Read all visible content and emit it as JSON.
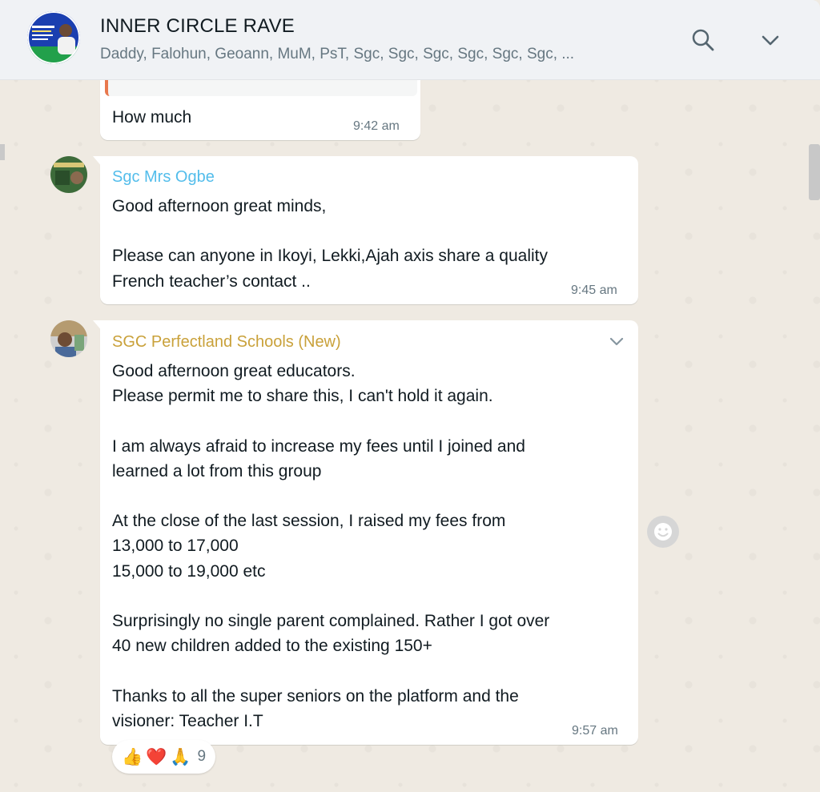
{
  "header": {
    "title": "INNER CIRCLE RAVE",
    "members": "Daddy, Falohun, Geoann, MuM, PsT, Sgc, Sgc, Sgc, Sgc, Sgc, Sgc, ...",
    "avatar_icon": "group-flyer-avatar",
    "search_icon": "search-icon",
    "menu_icon": "chevron-down-icon"
  },
  "messages": [
    {
      "text": "How much",
      "time": "9:42 am"
    },
    {
      "sender": "Sgc Mrs Ogbe",
      "sender_color": "#53bdeb",
      "text": "Good afternoon great minds,\n\nPlease can anyone in Ikoyi, Lekki,Ajah axis share a quality\nFrench teacher’s contact ..",
      "time": "9:45 am"
    },
    {
      "sender": "SGC Perfectland Schools (New)",
      "sender_color": "#c9a13a",
      "text": "Good afternoon great educators.\nPlease permit me to share this, I can't hold it again.\n\nI am always afraid to increase my fees until I joined and\nlearned a lot from this group\n\nAt the close of the last session, I raised my fees from\n13,000 to 17,000\n15,000 to 19,000 etc\n\nSurprisingly no single parent complained. Rather I got over\n40 new children added to the existing 150+\n\nThanks to all the super seniors on the platform and the\nvisioner: Teacher I.T",
      "time": "9:57 am",
      "reactions": {
        "emojis": [
          "👍",
          "❤️",
          "🙏"
        ],
        "count": "9"
      }
    }
  ],
  "colors": {
    "background": "#efeae2",
    "header": "#f0f2f5",
    "bubble": "#ffffff"
  }
}
